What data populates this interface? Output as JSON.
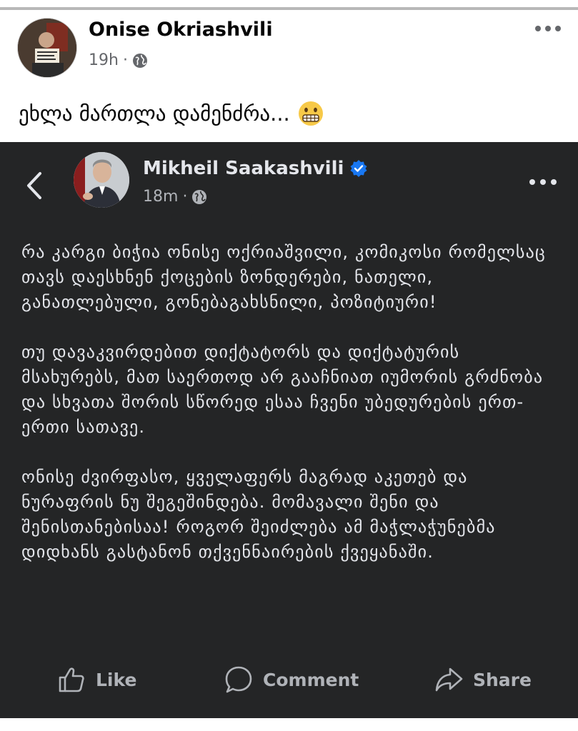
{
  "post": {
    "author": "Onise Okriashvili",
    "time": "19h",
    "dot": "·",
    "caption": "ეხლა მართლა დამენძრა..."
  },
  "shared": {
    "author": "Mikheil Saakashvili",
    "time": "18m",
    "dot": "·",
    "paragraphs": [
      "რა კარგი ბიჭია ონისე ოქრიაშვილი, კომიკოსი რომელსაც თავს დაესხნენ ქოცების ზონდერები, ნათელი, განათლებული, გონებაგახსნილი, პოზიტიური!",
      "თუ დავაკვირდებით დიქტატორს და დიქტატურის მსახურებს, მათ საერთოდ არ გააჩნიათ იუმორის გრძნობა და სხვათა შორის სწორედ ესაა ჩვენი უბედურების ერთ-ერთი სათავე.",
      "ონისე ძვირფასო, ყველაფერს მაგრად აკეთებ და ნურაფრის ნუ შეგეშინდება. მომავალი შენი და შენისთანებისაა! როგორ შეიძლება ამ მაჭლაჭუნებმა დიდხანს გასტანონ თქვენნაირების ქვეყანაში."
    ],
    "actions": {
      "like": "Like",
      "comment": "Comment",
      "share": "Share"
    }
  },
  "icons": {
    "globe": "globe-icon",
    "more": "more-options-icon",
    "back": "back-chevron-icon",
    "verified": "verified-badge-icon",
    "emoji": "grimacing-face-emoji"
  },
  "colors": {
    "dark_bg": "#242526",
    "verified": "#1877f2",
    "muted_text": "#b0b3b8"
  }
}
